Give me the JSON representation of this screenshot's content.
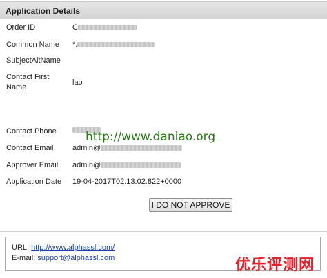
{
  "header": {
    "title": "Application Details"
  },
  "fields": {
    "order_id": {
      "label": "Order ID",
      "value": "C"
    },
    "common_name": {
      "label": "Common Name",
      "value": "*."
    },
    "subject_alt_name": {
      "label": "SubjectAltName",
      "value": ""
    },
    "contact_first_name": {
      "label": "Contact First Name",
      "value": "lao"
    },
    "contact_phone": {
      "label": "Contact Phone",
      "value": ""
    },
    "contact_email": {
      "label": "Contact Email",
      "value": "admin@"
    },
    "approver_email": {
      "label": "Approver Email",
      "value": "admin@"
    },
    "application_date": {
      "label": "Application Date",
      "value": "19-04-2017T02:13:02.822+0000"
    }
  },
  "actions": {
    "do_not_approve_label": "I DO NOT APPROVE"
  },
  "contact": {
    "url_label": "URL: ",
    "url": "http://www.alphassl.com/",
    "email_label": "E-mail: ",
    "email": "support@alphassl.com"
  },
  "watermarks": {
    "overlay_url": "http://www.daniao.org",
    "corner_text": "优乐评测网"
  },
  "colors": {
    "header_bg": "#dcdcdc",
    "watermark_green": "#2b7a1a",
    "watermark_red": "#e4212a",
    "link_blue": "#1a3fb5"
  }
}
